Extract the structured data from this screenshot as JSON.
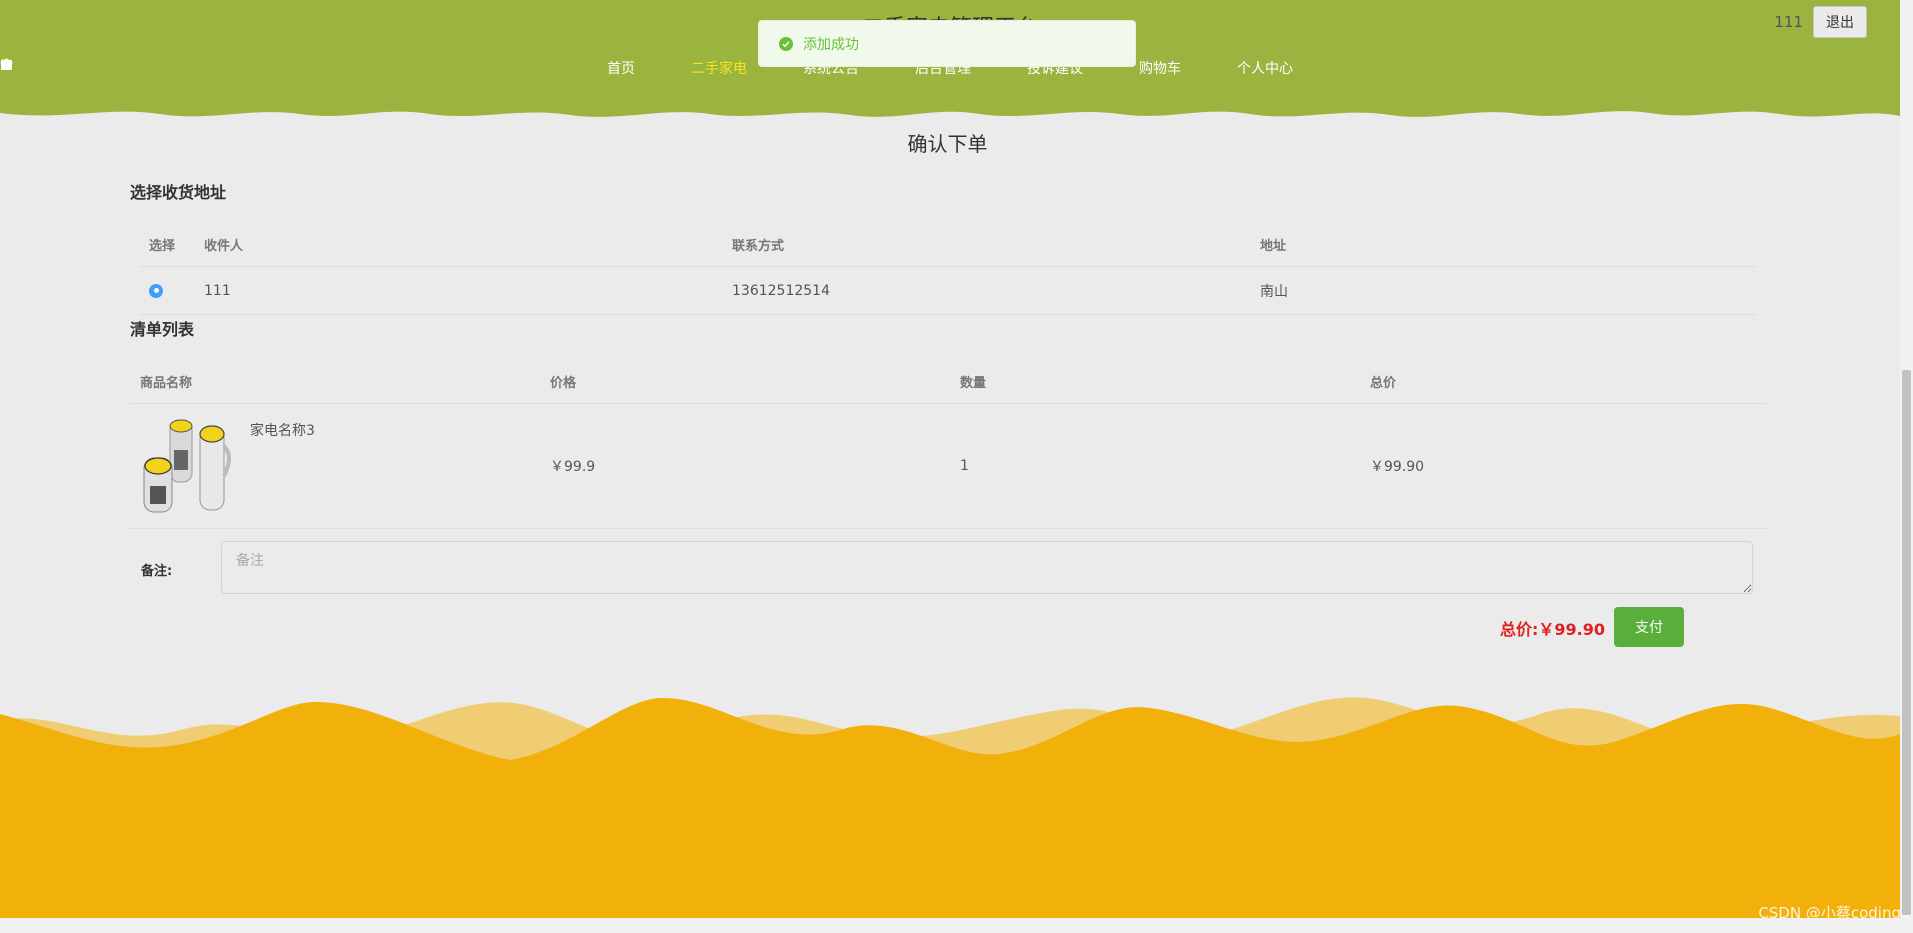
{
  "app": {
    "title": "二手家电管理平台"
  },
  "nav": {
    "items": [
      {
        "label": "首页",
        "icon": "star-icon"
      },
      {
        "label": "二手家电",
        "icon": "bag-icon",
        "active": true
      },
      {
        "label": "系统公告",
        "icon": "info-icon"
      },
      {
        "label": "后台管理",
        "icon": "admin-icon"
      },
      {
        "label": "投诉建议",
        "icon": "link-icon"
      },
      {
        "label": "购物车",
        "icon": "cart-icon"
      },
      {
        "label": "个人中心",
        "icon": "user-icon"
      }
    ]
  },
  "user": {
    "name": "111",
    "logout_label": "退出"
  },
  "toast": {
    "message": "添加成功",
    "icon": "check-circle-icon"
  },
  "page": {
    "heading": "确认下单"
  },
  "address": {
    "title": "选择收货地址",
    "headers": [
      "选择",
      "收件人",
      "联系方式",
      "地址"
    ],
    "rows": [
      {
        "receiver": "111",
        "phone": "13612512514",
        "address": "南山",
        "selected": true
      }
    ]
  },
  "order": {
    "title": "清单列表",
    "headers": [
      "商品名称",
      "价格",
      "数量",
      "总价"
    ],
    "rows": [
      {
        "name": "家电名称3",
        "price": "￥99.9",
        "quantity": "1",
        "total": "￥99.90"
      }
    ]
  },
  "note": {
    "label": "备注:",
    "placeholder": "备注",
    "value": ""
  },
  "summary": {
    "total_label": "总价:",
    "total_value": "￥99.90",
    "pay_label": "支付"
  },
  "watermark": "CSDN @小蔡coding",
  "colors": {
    "header": "#9ab43f",
    "accent_active": "#f6e51b",
    "footer": "#f2b00b",
    "pay": "#5aae3c",
    "price": "#e02020"
  }
}
